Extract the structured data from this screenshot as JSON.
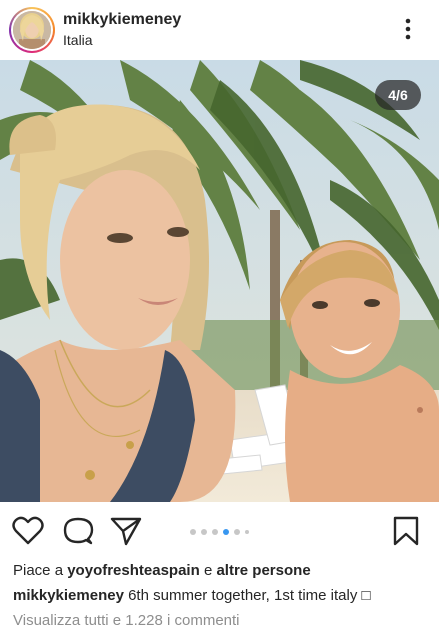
{
  "post": {
    "username": "mikkykiemeney",
    "location": "Italia",
    "slide_counter": "4/6"
  },
  "carousel": {
    "total_dots": 6,
    "active_index": 3
  },
  "likes": {
    "prefix": "Piace a",
    "user": "yoyofreshteaspain",
    "conjunction": "e",
    "others": "altre persone"
  },
  "caption": {
    "username": "mikkykiemeney",
    "text": "6th summer together, 1st time italy □"
  },
  "comments": {
    "link_text": "Visualizza tutti e 1.228 i commenti"
  },
  "icons": {
    "more": "more-vertical-icon",
    "like": "heart-icon",
    "comment": "comment-icon",
    "share": "send-icon",
    "save": "bookmark-icon"
  },
  "colors": {
    "text": "#262626",
    "muted": "#8e8e8e",
    "dot_active": "#3897f0",
    "dot_inactive": "#c7c7c7"
  }
}
